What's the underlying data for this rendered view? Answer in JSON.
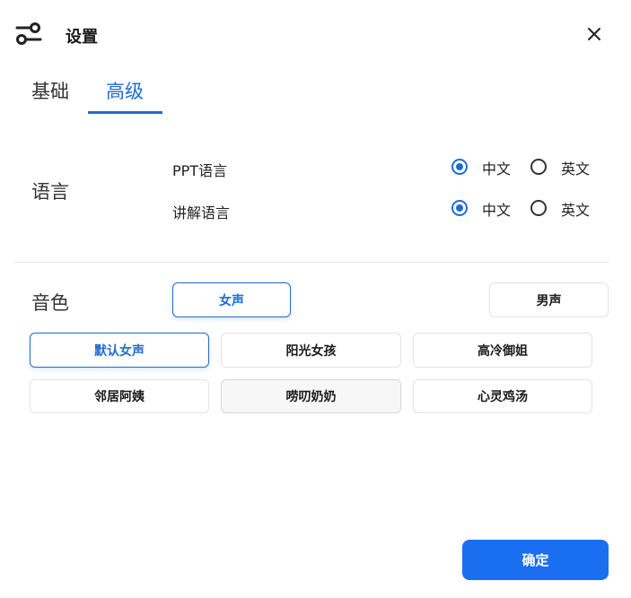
{
  "header": {
    "title": "设置",
    "settings_icon": "settings-sliders-icon",
    "close_icon": "close-icon"
  },
  "tabs": [
    {
      "label": "基础",
      "active": false
    },
    {
      "label": "高级",
      "active": true
    }
  ],
  "language": {
    "label": "语言",
    "rows": [
      {
        "label": "PPT语言",
        "options": [
          "中文",
          "英文"
        ],
        "selected": "中文"
      },
      {
        "label": "讲解语言",
        "options": [
          "中文",
          "英文"
        ],
        "selected": "中文"
      }
    ]
  },
  "voice": {
    "label": "音色",
    "gender": [
      {
        "label": "女声",
        "selected": true
      },
      {
        "label": "男声",
        "selected": false
      }
    ],
    "presets": [
      {
        "label": "默认女声",
        "selected": true
      },
      {
        "label": "阳光女孩",
        "selected": false
      },
      {
        "label": "高冷御姐",
        "selected": false
      },
      {
        "label": "邻居阿姨",
        "selected": false
      },
      {
        "label": "唠叨奶奶",
        "selected": false
      },
      {
        "label": "心灵鸡汤",
        "selected": false
      }
    ]
  },
  "footer": {
    "confirm_label": "确定"
  },
  "colors": {
    "accent": "#1f6bd1",
    "primary_button": "#1a6ff0"
  }
}
